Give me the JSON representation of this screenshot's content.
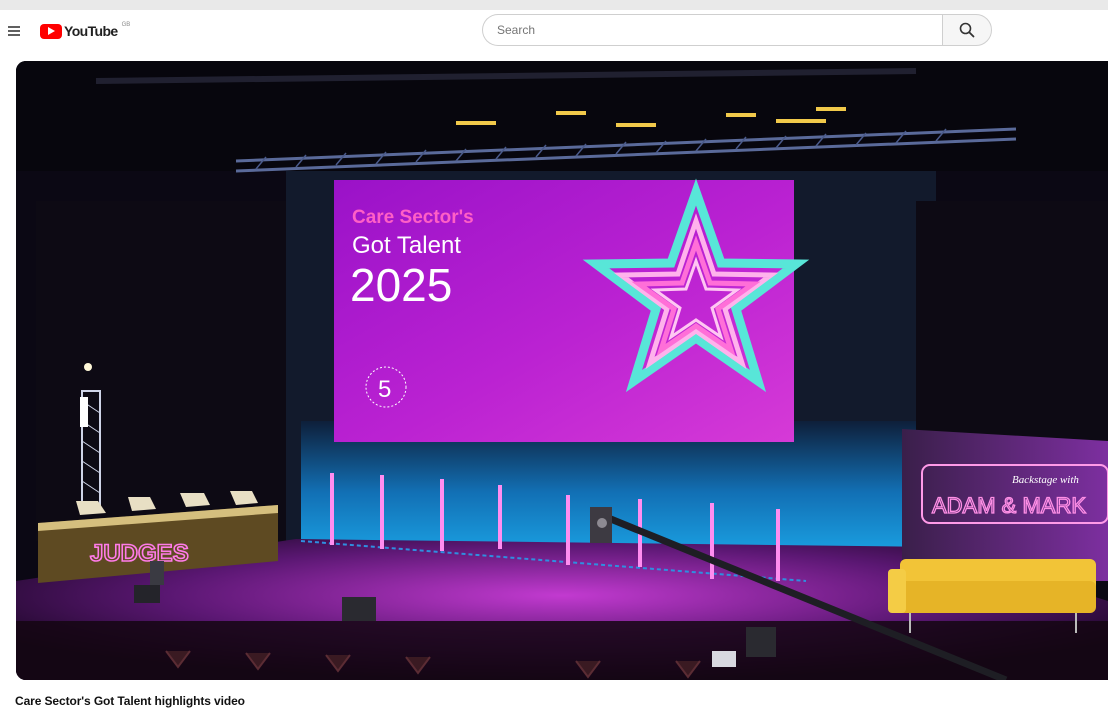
{
  "header": {
    "logo_text": "YouTube",
    "region": "GB",
    "brand_color": "#ff0000",
    "menu_icon": "hamburger-menu-icon",
    "search_placeholder": "Search",
    "search_icon": "search-icon"
  },
  "video": {
    "screen_line1": "Care Sector's",
    "screen_line2": "Got Talent",
    "screen_year": "2025",
    "screen_logo_number": "5",
    "judges_sign": "JUDGES",
    "backstage_small": "Backstage with",
    "backstage_big": "ADAM & MARK",
    "colors": {
      "screen_magenta": "#b21ad0",
      "neon_pink": "#ff4fd8",
      "neon_cyan": "#58e6d8",
      "stage_blue": "#1583c9",
      "sofa_yellow": "#f2c437"
    }
  },
  "video_title": "Care Sector's Got Talent highlights video"
}
